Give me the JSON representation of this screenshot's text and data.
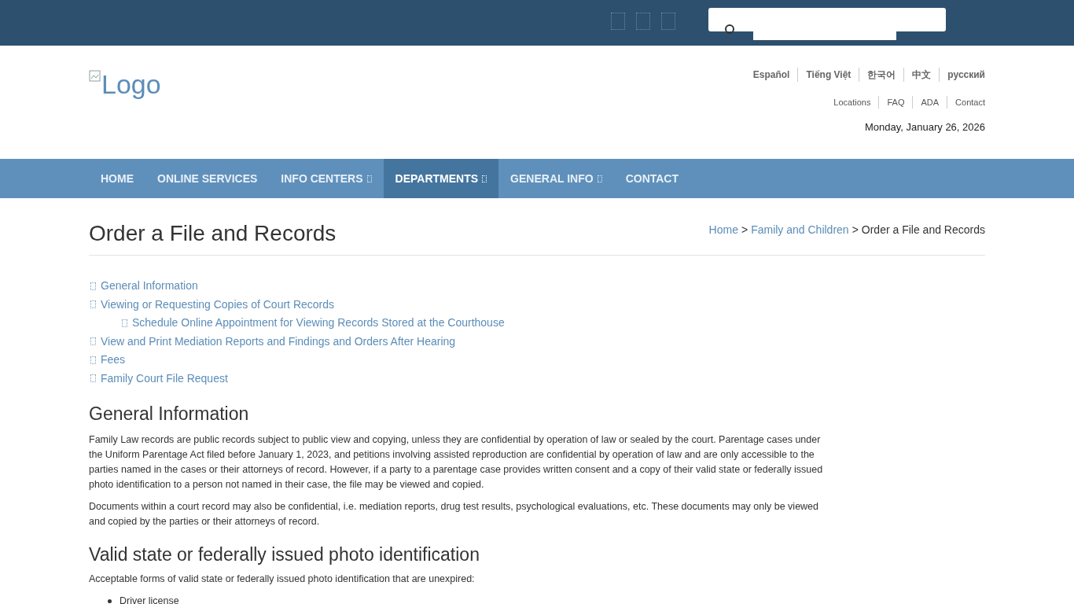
{
  "header": {
    "logo_alt": "Logo",
    "languages": [
      "Español",
      "Tiếng Việt",
      "한국어",
      "中文",
      "русский"
    ],
    "utility_links": [
      "Locations",
      "FAQ",
      "ADA",
      "Contact"
    ],
    "date": "Monday, January 26, 2026"
  },
  "nav": [
    {
      "label": "HOME",
      "dropdown": false,
      "selected": false
    },
    {
      "label": "ONLINE SERVICES",
      "dropdown": false,
      "selected": false
    },
    {
      "label": "INFO CENTERS",
      "dropdown": true,
      "selected": false
    },
    {
      "label": "DEPARTMENTS",
      "dropdown": true,
      "selected": true
    },
    {
      "label": "GENERAL INFO",
      "dropdown": true,
      "selected": false
    },
    {
      "label": "CONTACT",
      "dropdown": false,
      "selected": false
    }
  ],
  "page": {
    "title": "Order a File and Records",
    "breadcrumb_separator": ">",
    "breadcrumb": [
      {
        "label": "Home",
        "link": true
      },
      {
        "label": "Family and Children",
        "link": true
      },
      {
        "label": "Order a File and Records",
        "link": false
      }
    ]
  },
  "toc": [
    {
      "label": "General Information"
    },
    {
      "label": "Viewing or Requesting Copies of Court Records",
      "children": [
        {
          "label": "Schedule Online Appointment for Viewing Records Stored at the Courthouse"
        }
      ]
    },
    {
      "label": "View and Print Mediation Reports and Findings and Orders After Hearing"
    },
    {
      "label": "Fees"
    },
    {
      "label": "Family Court File Request"
    }
  ],
  "sections": [
    {
      "heading": "General Information",
      "paragraphs": [
        "Family Law records are public records subject to public view and copying, unless they are confidential by operation of law or sealed by the court. Parentage cases under the Uniform Parentage Act filed before January 1, 2023, and petitions involving assisted reproduction are confidential by operation of law and are only accessible to the parties named in the cases or their attorneys of record. However, if a party to a parentage case provides written consent and a copy of their valid state or federally issued photo identification to a person not named in their case, the file may be viewed and copied.",
        "Documents within a court record may also be confidential, i.e. mediation reports, drug test results, psychological evaluations, etc. These documents may only be viewed and copied by the parties or their attorneys of record."
      ]
    },
    {
      "heading": "Valid state or federally issued photo identification",
      "paragraphs": [
        "Acceptable forms of valid state or federally issued photo identification that are unexpired:"
      ],
      "bullets": [
        "Driver license"
      ]
    }
  ]
}
